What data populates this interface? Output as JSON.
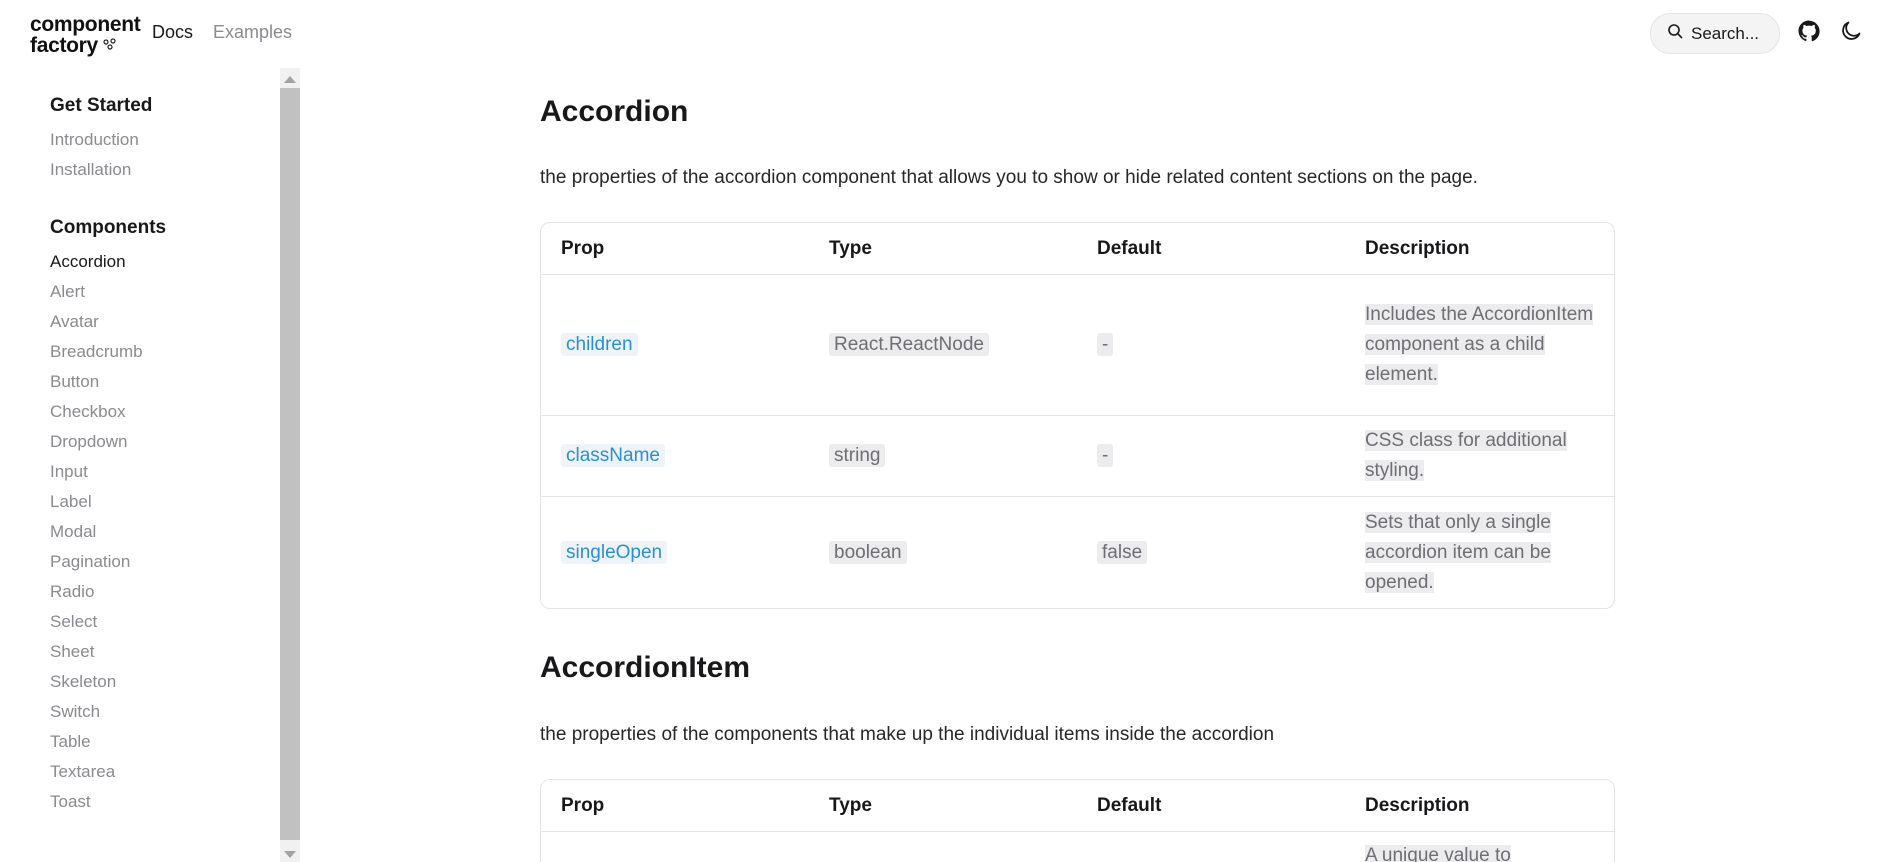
{
  "header": {
    "logo_line1": "component",
    "logo_line2": "factory",
    "nav": {
      "docs": "Docs",
      "examples": "Examples"
    },
    "search_label": "Search..."
  },
  "sidebar": {
    "sections": [
      {
        "title": "Get Started",
        "items": [
          "Introduction",
          "Installation"
        ]
      },
      {
        "title": "Components",
        "items": [
          "Accordion",
          "Alert",
          "Avatar",
          "Breadcrumb",
          "Button",
          "Checkbox",
          "Dropdown",
          "Input",
          "Label",
          "Modal",
          "Pagination",
          "Radio",
          "Select",
          "Sheet",
          "Skeleton",
          "Switch",
          "Table",
          "Textarea",
          "Toast"
        ]
      }
    ],
    "active_item": "Accordion"
  },
  "main": {
    "accordion": {
      "title": "Accordion",
      "description": "the properties of the accordion component that allows you to show or hide related content sections on the page.",
      "headers": [
        "Prop",
        "Type",
        "Default",
        "Description"
      ],
      "rows": [
        {
          "prop": "children",
          "type": "React.ReactNode",
          "default": "-",
          "description": " Includes the AccordionItem component as a child element. "
        },
        {
          "prop": "className",
          "type": "string",
          "default": "-",
          "description": " CSS class for additional styling. "
        },
        {
          "prop": "singleOpen",
          "type": "boolean",
          "default": "false",
          "description": " Sets that only a single accordion item can be opened. "
        }
      ]
    },
    "accordion_item": {
      "title": "AccordionItem",
      "description": "the properties of the components that make up the individual items inside the accordion",
      "headers": [
        "Prop",
        "Type",
        "Default",
        "Description"
      ],
      "rows": [
        {
          "description_partial": " A unique value to"
        }
      ]
    }
  }
}
